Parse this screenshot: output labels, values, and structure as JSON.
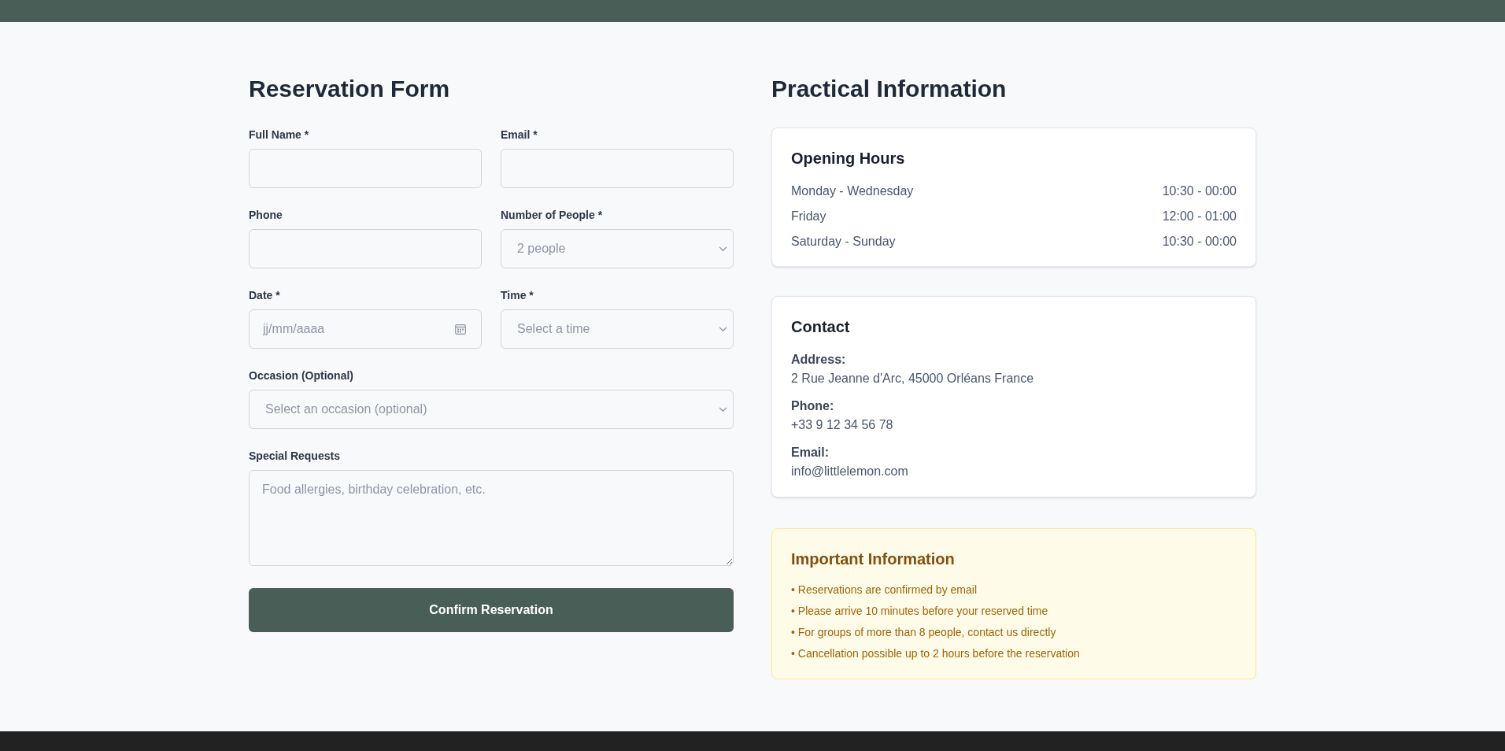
{
  "reservation_form": {
    "title": "Reservation Form",
    "rows": [
      [
        {
          "kind": "text",
          "label": "Full Name *"
        },
        {
          "kind": "email",
          "label": "Email *"
        }
      ],
      [
        {
          "kind": "tel",
          "label": "Phone"
        },
        {
          "kind": "select",
          "label": "Number of People *",
          "placeholder": "2 people"
        }
      ],
      [
        {
          "kind": "date",
          "label": "Date *",
          "placeholder": "jj/mm/aaaa"
        },
        {
          "kind": "select",
          "label": "Time *",
          "placeholder": "Select a time"
        }
      ],
      [
        {
          "kind": "select",
          "label": "Occasion (Optional)",
          "placeholder": "Select an occasion (optional)"
        }
      ],
      [
        {
          "kind": "textarea",
          "label": "Special Requests",
          "placeholder": "Food allergies, birthday celebration, etc."
        }
      ]
    ],
    "submit_button": "Confirm Reservation"
  },
  "practical_information": {
    "title": "Practical Information",
    "opening_hours": {
      "title": "Opening Hours",
      "rows": [
        {
          "days": "Monday - Wednesday",
          "hours": "10:30 - 00:00"
        },
        {
          "days": "Friday",
          "hours": "12:00 - 01:00"
        },
        {
          "days": "Saturday - Sunday",
          "hours": "10:30 - 00:00"
        }
      ]
    },
    "contact": {
      "title": "Contact",
      "items": [
        {
          "label": "Address:",
          "value": "2 Rue Jeanne d'Arc, 45000 Orléans France"
        },
        {
          "label": "Phone:",
          "value": "+33 9 12 34 56 78"
        },
        {
          "label": "Email:",
          "value": "info@littlelemon.com"
        }
      ]
    },
    "important_information": {
      "title": "Important Information",
      "items": [
        "• Reservations are confirmed by email",
        "• Please arrive 10 minutes before your reserved time",
        "• For groups of more than 8 people, contact us directly",
        "• Cancellation possible up to 2 hours before the reservation"
      ]
    }
  }
}
